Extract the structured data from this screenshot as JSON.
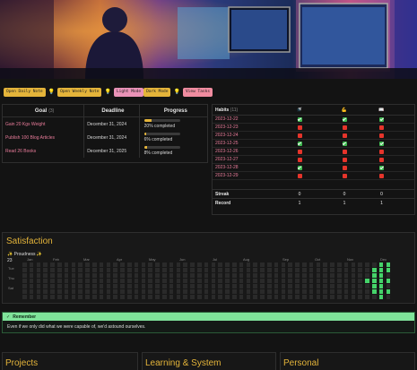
{
  "toolbar": {
    "buttons": [
      {
        "label": "Open Daily Note",
        "color": "#e4b43a"
      },
      {
        "label": "Open Weekly Note",
        "color": "#e4b43a"
      },
      {
        "label": "Light Mode",
        "color": "#e992b7"
      },
      {
        "label": "Dark Mode",
        "color": "#e4b43a"
      },
      {
        "label": "View Tasks",
        "color": "#f08ca0"
      }
    ]
  },
  "goals": {
    "headers": {
      "goal": "Goal",
      "count": "(3)",
      "deadline": "Deadline",
      "progress": "Progress"
    },
    "rows": [
      {
        "name": "Gain 20 Kgs Weight",
        "deadline": "December 31, 2024",
        "progress_text": "20% completed",
        "progress": 0.2
      },
      {
        "name": "Publish 100 Blog Articles",
        "deadline": "December 31, 2024",
        "progress_text": "6% completed",
        "progress": 0.06
      },
      {
        "name": "Read 26 Books",
        "deadline": "December 31, 2025",
        "progress_text": "8% completed",
        "progress": 0.08
      }
    ]
  },
  "habits": {
    "title": "Habits",
    "count": "(11)",
    "icons": [
      "🚿",
      "💪",
      "📖"
    ],
    "rows": [
      {
        "date": "2023-12-22",
        "v": [
          1,
          1,
          1
        ]
      },
      {
        "date": "2023-12-23",
        "v": [
          0,
          0,
          0
        ]
      },
      {
        "date": "2023-12-24",
        "v": [
          0,
          0,
          0
        ]
      },
      {
        "date": "2023-12-25",
        "v": [
          1,
          1,
          1
        ]
      },
      {
        "date": "2023-12-26",
        "v": [
          0,
          0,
          0
        ]
      },
      {
        "date": "2023-12-27",
        "v": [
          0,
          0,
          0
        ]
      },
      {
        "date": "2023-12-28",
        "v": [
          1,
          0,
          1
        ]
      },
      {
        "date": "2023-12-29",
        "v": [
          0,
          0,
          0
        ]
      }
    ],
    "streak": {
      "label": "Streak",
      "values": [
        "0",
        "0",
        "0"
      ]
    },
    "record": {
      "label": "Record",
      "values": [
        "1",
        "1",
        "1"
      ]
    }
  },
  "satisfaction": {
    "title": "Satisfaction",
    "proudness": "Proudness",
    "year": "23",
    "months": [
      "Jan",
      "Feb",
      "Mar",
      "Apr",
      "May",
      "Jun",
      "Jul",
      "Aug",
      "Sep",
      "Oct",
      "Nov",
      "Dec"
    ],
    "days": [
      "Tue",
      "Thu",
      "Sat"
    ],
    "active_cells": [
      [
        49,
        3
      ],
      [
        50,
        1
      ],
      [
        50,
        2
      ],
      [
        50,
        3
      ],
      [
        50,
        4
      ],
      [
        50,
        5
      ],
      [
        51,
        0
      ],
      [
        51,
        1
      ],
      [
        51,
        2
      ],
      [
        51,
        3
      ],
      [
        51,
        4
      ],
      [
        51,
        5
      ],
      [
        51,
        6
      ],
      [
        52,
        0
      ],
      [
        52,
        1
      ],
      [
        52,
        3
      ],
      [
        52,
        5
      ]
    ]
  },
  "remember": {
    "title": "Remember",
    "text": "Even if we only did what we were capable of, we'd astound ourselves."
  },
  "sections": [
    "Projects",
    "Learning & System",
    "Personal"
  ],
  "colors": {
    "accent": "#e4b43a",
    "pink": "#e97c9a",
    "green": "#3fb950",
    "red": "#e5342b",
    "heat": "#45d36a"
  }
}
